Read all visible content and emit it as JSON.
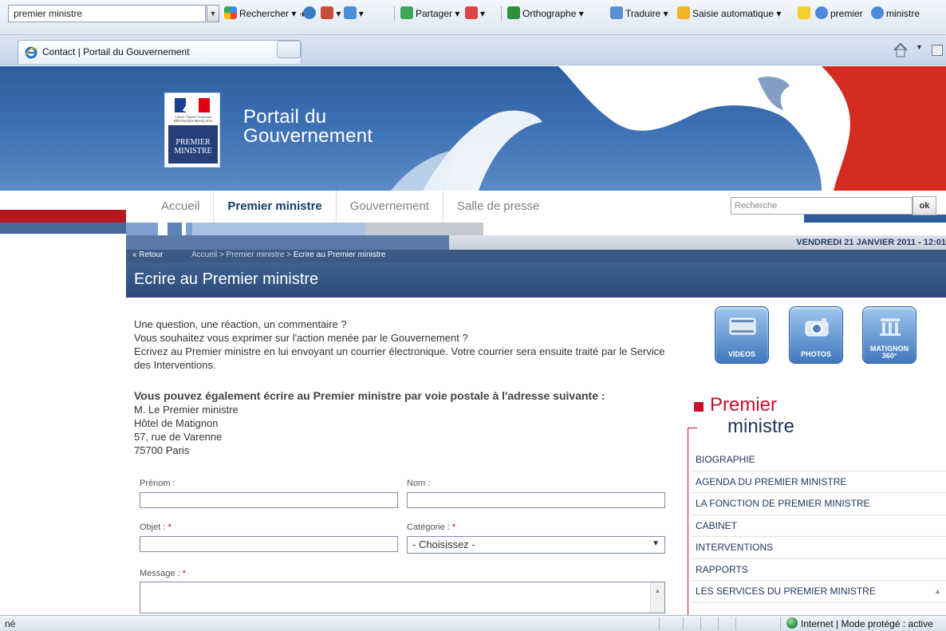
{
  "browser": {
    "toolbar": {
      "search_value": "premier ministre",
      "rechercher_label": "Rechercher",
      "partager_label": "Partager",
      "orthographe_label": "Orthographe",
      "traduire_label": "Traduire",
      "saisie_label": "Saisie automatique",
      "highlight_1": "premier",
      "highlight_2": "ministre"
    },
    "tab_title": "Contact | Portail du Gouvernement"
  },
  "site": {
    "title_line1": "Portail du",
    "title_line2": "Gouvernement",
    "logo_text": "PREMIER MINISTRE",
    "logo_mini": "Liberté • Égalité • Fraternité RÉPUBLIQUE FRANÇAISE"
  },
  "nav": {
    "items": [
      "Accueil",
      "Premier ministre",
      "Gouvernement",
      "Salle de presse"
    ],
    "active": "Premier ministre",
    "search_placeholder": "Recherche",
    "search_button": "ok"
  },
  "date": "VENDREDI 21 JANVIER 2011 - 12:01",
  "breadcrumb": {
    "back": "Retour",
    "items": [
      "Accueil",
      "Premier ministre",
      "Ecrire au Premier ministre"
    ]
  },
  "page_title": "Ecrire au Premier ministre",
  "intro": {
    "line1": "Une question, une réaction, un commentaire ?",
    "line2": "Vous souhaitez vous exprimer sur l'action menée par le Gouvernement ?",
    "line3": "Ecrivez au Premier ministre en lui envoyant un courrier électronique. Votre courrier sera ensuite traité par le Service des Interventions."
  },
  "postal": {
    "heading": "Vous pouvez également écrire au Premier ministre par voie postale à l'adresse suivante :",
    "lines": [
      "M. Le Premier ministre",
      "Hôtel de Matignon",
      "57, rue de Varenne",
      "75700 Paris"
    ]
  },
  "form": {
    "prenom_label": "Prénom :",
    "nom_label": "Nom :",
    "objet_label": "Objet :",
    "categorie_label": "Catégorie :",
    "categorie_value": "- Choisissez -",
    "message_label": "Message :",
    "required_mark": "*"
  },
  "media": {
    "videos": "VIDEOS",
    "photos": "PHOTOS",
    "matignon": "MATIGNON",
    "matignon_sub": "360°"
  },
  "sidebar": {
    "title_1": "Premier",
    "title_2": "ministre",
    "items": [
      "BIOGRAPHIE",
      "AGENDA DU PREMIER MINISTRE",
      "LA FONCTION DE PREMIER MINISTRE",
      "CABINET",
      "INTERVENTIONS",
      "RAPPORTS",
      "LES SERVICES DU PREMIER MINISTRE"
    ]
  },
  "status": {
    "left": "né",
    "right": "Internet | Mode protégé : active"
  }
}
